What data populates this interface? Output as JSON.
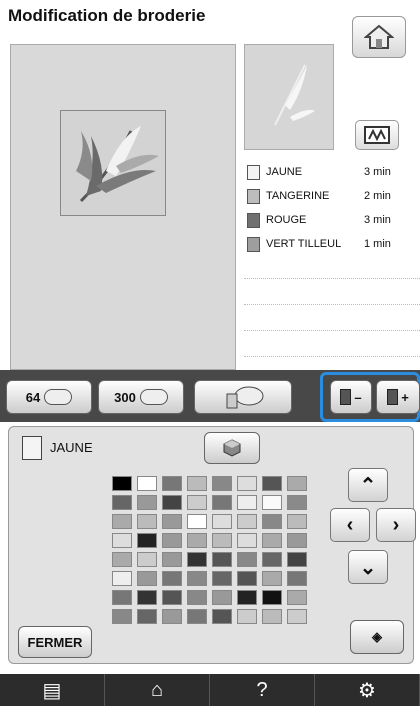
{
  "header": {
    "title": "Modification de broderie"
  },
  "colors": [
    {
      "name": "JAUNE",
      "time": "3 min",
      "swatch": "#f4f4f4"
    },
    {
      "name": "TANGERINE",
      "time": "2 min",
      "swatch": "#bdbdbd"
    },
    {
      "name": "ROUGE",
      "time": "3 min",
      "swatch": "#707070"
    },
    {
      "name": "VERT TILLEUL",
      "time": "1 min",
      "swatch": "#9e9e9e"
    }
  ],
  "toolbar": {
    "btn64": "64",
    "btn300": "300",
    "minus": "–",
    "plus": "+"
  },
  "palette": {
    "selected_color": "JAUNE",
    "close_label": "FERMER"
  },
  "nav": {
    "help": "?"
  }
}
